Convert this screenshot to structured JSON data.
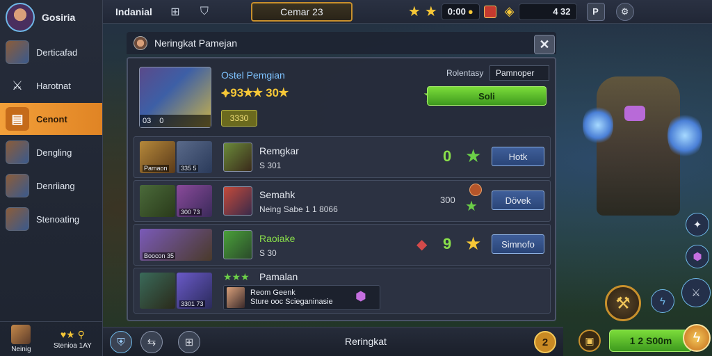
{
  "profile": {
    "name": "Gosiria"
  },
  "sidebar": {
    "items": [
      {
        "label": "Derticafad",
        "icon": "hero-portrait"
      },
      {
        "label": "Harotnat",
        "icon": "sword-icon"
      },
      {
        "label": "Cenont",
        "icon": "scroll-icon",
        "active": true
      },
      {
        "label": "Dengling",
        "icon": "hero-portrait"
      },
      {
        "label": "Denriiang",
        "icon": "hero-portrait"
      },
      {
        "label": "Stenoating",
        "icon": "hero-portrait"
      }
    ],
    "footer": {
      "left_label": "Neinig",
      "right_label": "Stenioa 1AY"
    }
  },
  "topbar": {
    "title": "Indanial",
    "tab_label": "Cemar 23",
    "gold_value": "0:00",
    "gem_value": "4 32",
    "pause_label": "P",
    "settings_icon": "gear-icon"
  },
  "panel": {
    "title": "Neringkat Pamejan",
    "close_label": "✕",
    "hero": {
      "name": "Ostel Pemgian",
      "stars_text": "⯌93★★ 30★",
      "caption_left": "03",
      "caption_right": "0",
      "badge": "3330"
    },
    "filter": {
      "label": "Rolentasy",
      "value": "Pamnoper"
    },
    "green_button": "Soli",
    "rows": [
      {
        "team_label": "Pamaon",
        "team_sub": "335 5",
        "opp_name": "Remgkar",
        "opp_sub": "S 301",
        "score": "0",
        "button": "Hotk"
      },
      {
        "team_label": "300 73",
        "opp_name": "Semahk",
        "opp_sub": "Neing Sabe 1 1 8066",
        "score_label": "300",
        "button": "Dövek"
      },
      {
        "team_label": "Boocon 35",
        "opp_name": "Raoiake",
        "opp_sub": "S 30",
        "score": "9",
        "button": "Simnofo"
      },
      {
        "team_label": "3301 73",
        "opp_name": "Pamalan",
        "stars": "★★★",
        "info_line1": "Reom Geenk",
        "info_line2": "Sture ooc Scieganinasie"
      }
    ]
  },
  "bottombar": {
    "label": "Reringkat",
    "level": "2"
  },
  "right": {
    "play_label": "1 2 S00m"
  },
  "colors": {
    "accent": "#f3a03a",
    "green": "#7bdc3a",
    "blue": "#3f5f9a",
    "gold": "#f6c737"
  }
}
